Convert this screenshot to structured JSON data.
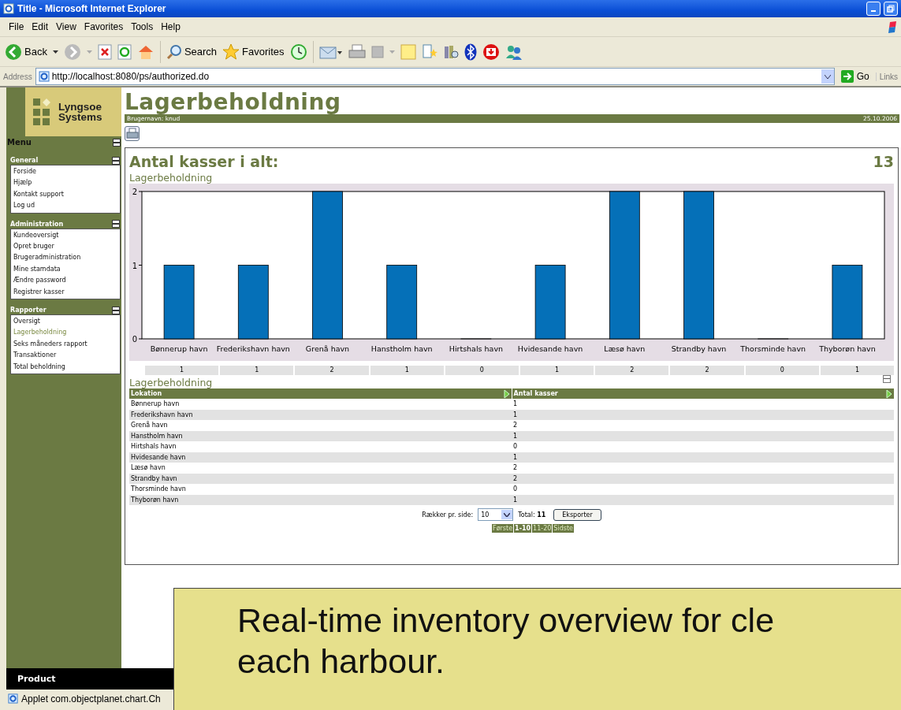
{
  "window": {
    "title": "Title - Microsoft Internet Explorer"
  },
  "menu_bar": [
    "File",
    "Edit",
    "View",
    "Favorites",
    "Tools",
    "Help"
  ],
  "toolbar": {
    "back": "Back",
    "search": "Search",
    "favorites": "Favorites"
  },
  "address_bar": {
    "label": "Address",
    "url": "http://localhost:8080/ps/authorized.do",
    "go": "Go",
    "links": "Links"
  },
  "sidebar": {
    "logo": [
      "Lyngsoe",
      "Systems"
    ],
    "menu_title": "Menu",
    "sections": [
      {
        "title": "General",
        "items": [
          {
            "label": "Forside",
            "selected": false
          },
          {
            "label": "Hjælp",
            "selected": false
          },
          {
            "label": "Kontakt support",
            "selected": false
          },
          {
            "label": "Log ud",
            "selected": false
          }
        ]
      },
      {
        "title": "Administration",
        "items": [
          {
            "label": "Kundeoversigt",
            "selected": false
          },
          {
            "label": "Opret bruger",
            "selected": false
          },
          {
            "label": "Brugeradministration",
            "selected": false
          },
          {
            "label": "Mine stamdata",
            "selected": false
          },
          {
            "label": "Ændre password",
            "selected": false
          },
          {
            "label": "Registrer kasser",
            "selected": false
          }
        ]
      },
      {
        "title": "Rapporter",
        "items": [
          {
            "label": "Oversigt",
            "selected": false
          },
          {
            "label": "Lagerbeholdning",
            "selected": true
          },
          {
            "label": "Seks måneders rapport",
            "selected": false
          },
          {
            "label": "Transaktioner",
            "selected": false
          },
          {
            "label": "Total beholdning",
            "selected": false
          }
        ]
      }
    ]
  },
  "header": {
    "title": "Lagerbeholdning",
    "user": "Brugernavn: knud",
    "date": "25.10.2006"
  },
  "panel": {
    "heading": "Antal kasser i alt:",
    "total": "13",
    "chart_title": "Lagerbeholdning",
    "chart_data": {
      "type": "bar",
      "categories": [
        "Bønnerup havn",
        "Frederikshavn havn",
        "Grenå havn",
        "Hanstholm havn",
        "Hirtshals havn",
        "Hvidesande havn",
        "Læsø havn",
        "Strandby havn",
        "Thorsminde havn",
        "Thyborøn havn"
      ],
      "series": [
        {
          "color": "#0570b8",
          "values": [
            1,
            1,
            2,
            1,
            0,
            1,
            2,
            2,
            0,
            1
          ]
        }
      ],
      "ylim": [
        0,
        2
      ],
      "yticks": [
        0,
        1,
        2
      ]
    },
    "value_row": [
      "1",
      "1",
      "2",
      "1",
      "0",
      "1",
      "2",
      "2",
      "0",
      "1"
    ],
    "table_title": "Lagerbeholdning",
    "columns": [
      "Lokation",
      "Antal kasser"
    ],
    "rows": [
      [
        "Bønnerup havn",
        "1"
      ],
      [
        "Frederikshavn havn",
        "1"
      ],
      [
        "Grenå havn",
        "2"
      ],
      [
        "Hanstholm havn",
        "1"
      ],
      [
        "Hirtshals havn",
        "0"
      ],
      [
        "Hvidesande havn",
        "1"
      ],
      [
        "Læsø havn",
        "2"
      ],
      [
        "Strandby havn",
        "2"
      ],
      [
        "Thorsminde havn",
        "0"
      ],
      [
        "Thyborøn havn",
        "1"
      ]
    ],
    "pager": {
      "rows_label": "Rækker pr. side:",
      "rows_value": "10",
      "total_label": "Total:",
      "total": "11",
      "export": "Eksporter",
      "pages": [
        {
          "label": "Første",
          "selected": false
        },
        {
          "label": "1-10",
          "selected": true
        },
        {
          "label": "11-20",
          "selected": false
        },
        {
          "label": "Sidste",
          "selected": false
        }
      ]
    }
  },
  "footer": "Product",
  "status_bar": "Applet com.objectplanet.chart.Ch",
  "caption": [
    "Real-time inventory overview for cle",
    "each harbour."
  ]
}
